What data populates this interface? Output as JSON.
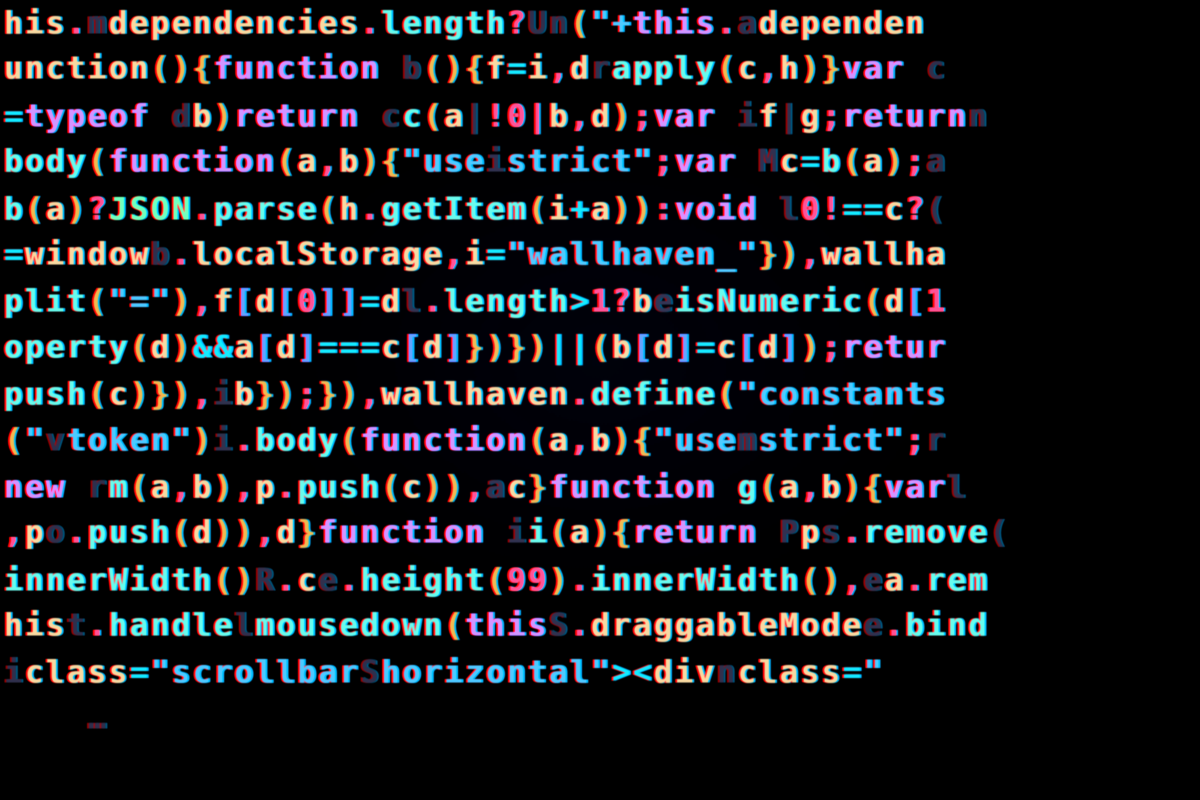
{
  "meta": {
    "description": "Close-up macro photo of a syntax-highlighted minified JavaScript file on an LCD screen, with chromatic aberration. Text is cropped on all sides.",
    "font": "monospace",
    "approx_font_px": 31,
    "line_height_px": 46.4,
    "columns_visible_approx": 55,
    "colors": {
      "background": "#000000",
      "identifier": "#e6d6b8",
      "function": "#9ae8e0",
      "keyword": "#bfa0ff",
      "number_punc": "#ff6e92",
      "string": "#7bbde0",
      "operator": "#61d4e6",
      "paren_brace": "#d5b880",
      "bracket": "#7ea0ff",
      "dim": "#6a6a88",
      "type": "#a8ffd0"
    }
  },
  "syntax_legend": {
    "id": "identifier",
    "fn": "function-name",
    "kw": "keyword",
    "num": "number-literal",
    "str": "string-literal",
    "op": "operator",
    "pun": "paren-or-brace",
    "brkt": "square-bracket",
    "dim": "ghost-char",
    "type": "builtin-type"
  },
  "code_lines": [
    [
      [
        "id",
        "his"
      ],
      [
        "num",
        "."
      ],
      [
        "dim",
        "m"
      ],
      [
        "id",
        "dependencies"
      ],
      [
        "num",
        "."
      ],
      [
        "fn",
        "length"
      ],
      [
        "num",
        "?"
      ],
      [
        "dim",
        "Un"
      ],
      [
        "pun",
        "("
      ],
      [
        "str",
        "\"+"
      ],
      [
        "kw",
        "this"
      ],
      [
        "num",
        "."
      ],
      [
        "dim",
        "a"
      ],
      [
        "id",
        "dependen"
      ]
    ],
    [
      [
        "id",
        "unction"
      ],
      [
        "pun",
        "("
      ],
      [
        "pun",
        ")"
      ],
      [
        "pun",
        "{"
      ],
      [
        "kw",
        "function "
      ],
      [
        "dim",
        "b"
      ],
      [
        "pun",
        "("
      ],
      [
        "pun",
        ")"
      ],
      [
        "pun",
        "{"
      ],
      [
        "id",
        "f"
      ],
      [
        "op",
        "="
      ],
      [
        "id",
        "i"
      ],
      [
        "num",
        ","
      ],
      [
        "id",
        "d"
      ],
      [
        "dim",
        "r"
      ],
      [
        "fn",
        "apply"
      ],
      [
        "pun",
        "("
      ],
      [
        "id",
        "c"
      ],
      [
        "num",
        ","
      ],
      [
        "id",
        "h"
      ],
      [
        "pun",
        ")"
      ],
      [
        "pun",
        "}"
      ],
      [
        "kw",
        "var "
      ],
      [
        "dim",
        "c"
      ]
    ],
    [
      [
        "op",
        "="
      ],
      [
        "kw",
        "typeof "
      ],
      [
        "dim",
        "d"
      ],
      [
        "id",
        "b"
      ],
      [
        "pun",
        ")"
      ],
      [
        "kw",
        "return "
      ],
      [
        "dim",
        "c"
      ],
      [
        "fn",
        "c"
      ],
      [
        "pun",
        "("
      ],
      [
        "id",
        "a"
      ],
      [
        "dim",
        "|"
      ],
      [
        "num",
        "!"
      ],
      [
        "num",
        "0"
      ],
      [
        "num",
        "|"
      ],
      [
        "id",
        "b"
      ],
      [
        "num",
        ","
      ],
      [
        "id",
        "d"
      ],
      [
        "pun",
        ")"
      ],
      [
        "num",
        ";"
      ],
      [
        "kw",
        "var "
      ],
      [
        "dim",
        "i"
      ],
      [
        "id",
        "f"
      ],
      [
        "dim",
        "|"
      ],
      [
        "id",
        "g"
      ],
      [
        "num",
        ";"
      ],
      [
        "kw",
        "return"
      ],
      [
        "dim",
        "n"
      ]
    ],
    [
      [
        "fn",
        "body"
      ],
      [
        "pun",
        "("
      ],
      [
        "kw",
        "function"
      ],
      [
        "pun",
        "("
      ],
      [
        "id",
        "a"
      ],
      [
        "num",
        ","
      ],
      [
        "id",
        "b"
      ],
      [
        "pun",
        ")"
      ],
      [
        "pun",
        "{"
      ],
      [
        "str",
        "\"use"
      ],
      [
        "dim",
        "i"
      ],
      [
        "str",
        "strict\""
      ],
      [
        "num",
        ";"
      ],
      [
        "kw",
        "var "
      ],
      [
        "dim",
        "M"
      ],
      [
        "id",
        "c"
      ],
      [
        "op",
        "="
      ],
      [
        "fn",
        "b"
      ],
      [
        "pun",
        "("
      ],
      [
        "id",
        "a"
      ],
      [
        "pun",
        ")"
      ],
      [
        "num",
        ";"
      ],
      [
        "dim",
        "a"
      ]
    ],
    [
      [
        "fn",
        "b"
      ],
      [
        "pun",
        "("
      ],
      [
        "id",
        "a"
      ],
      [
        "pun",
        ")"
      ],
      [
        "num",
        "?"
      ],
      [
        "type",
        "JSON"
      ],
      [
        "num",
        "."
      ],
      [
        "fn",
        "parse"
      ],
      [
        "pun",
        "("
      ],
      [
        "id",
        "h"
      ],
      [
        "num",
        "."
      ],
      [
        "fn",
        "getItem"
      ],
      [
        "pun",
        "("
      ],
      [
        "id",
        "i"
      ],
      [
        "op",
        "+"
      ],
      [
        "id",
        "a"
      ],
      [
        "pun",
        ")"
      ],
      [
        "pun",
        ")"
      ],
      [
        "num",
        ":"
      ],
      [
        "kw",
        "void "
      ],
      [
        "dim",
        "l"
      ],
      [
        "num",
        "0"
      ],
      [
        "num",
        "!"
      ],
      [
        "op",
        "=="
      ],
      [
        "id",
        "c"
      ],
      [
        "num",
        "?"
      ],
      [
        "dim",
        "("
      ]
    ],
    [
      [
        "op",
        "="
      ],
      [
        "id",
        "window"
      ],
      [
        "dim",
        "b"
      ],
      [
        "num",
        "."
      ],
      [
        "id",
        "localStorage"
      ],
      [
        "num",
        ","
      ],
      [
        "id",
        "i"
      ],
      [
        "op",
        "="
      ],
      [
        "str",
        "\"wallhaven_\""
      ],
      [
        "pun",
        "}"
      ],
      [
        "pun",
        ")"
      ],
      [
        "num",
        ","
      ],
      [
        "id",
        "wallha"
      ]
    ],
    [
      [
        "fn",
        "plit"
      ],
      [
        "pun",
        "("
      ],
      [
        "str",
        "\"=\""
      ],
      [
        "pun",
        ")"
      ],
      [
        "num",
        ","
      ],
      [
        "id",
        "f"
      ],
      [
        "brkt",
        "["
      ],
      [
        "id",
        "d"
      ],
      [
        "brkt",
        "["
      ],
      [
        "num",
        "0"
      ],
      [
        "brkt",
        "]"
      ],
      [
        "brkt",
        "]"
      ],
      [
        "op",
        "="
      ],
      [
        "id",
        "d"
      ],
      [
        "dim",
        "l"
      ],
      [
        "num",
        "."
      ],
      [
        "fn",
        "length"
      ],
      [
        "op",
        ">"
      ],
      [
        "num",
        "1"
      ],
      [
        "num",
        "?"
      ],
      [
        "id",
        "b"
      ],
      [
        "dim",
        "e"
      ],
      [
        "fn",
        "isNumeric"
      ],
      [
        "pun",
        "("
      ],
      [
        "id",
        "d"
      ],
      [
        "brkt",
        "["
      ],
      [
        "num",
        "1"
      ]
    ],
    [
      [
        "fn",
        "operty"
      ],
      [
        "pun",
        "("
      ],
      [
        "id",
        "d"
      ],
      [
        "pun",
        ")"
      ],
      [
        "op",
        "&&"
      ],
      [
        "id",
        "a"
      ],
      [
        "brkt",
        "["
      ],
      [
        "id",
        "d"
      ],
      [
        "brkt",
        "]"
      ],
      [
        "op",
        "==="
      ],
      [
        "id",
        "c"
      ],
      [
        "brkt",
        "["
      ],
      [
        "id",
        "d"
      ],
      [
        "brkt",
        "]"
      ],
      [
        "pun",
        "}"
      ],
      [
        "pun",
        ")"
      ],
      [
        "pun",
        "}"
      ],
      [
        "pun",
        ")"
      ],
      [
        "op",
        "||"
      ],
      [
        "pun",
        "("
      ],
      [
        "id",
        "b"
      ],
      [
        "brkt",
        "["
      ],
      [
        "id",
        "d"
      ],
      [
        "brkt",
        "]"
      ],
      [
        "op",
        "="
      ],
      [
        "id",
        "c"
      ],
      [
        "brkt",
        "["
      ],
      [
        "id",
        "d"
      ],
      [
        "brkt",
        "]"
      ],
      [
        "pun",
        ")"
      ],
      [
        "num",
        ";"
      ],
      [
        "kw",
        "retur"
      ]
    ],
    [
      [
        "fn",
        "push"
      ],
      [
        "pun",
        "("
      ],
      [
        "id",
        "c"
      ],
      [
        "pun",
        ")"
      ],
      [
        "pun",
        "}"
      ],
      [
        "pun",
        ")"
      ],
      [
        "num",
        ","
      ],
      [
        "dim",
        "i"
      ],
      [
        "id",
        "b"
      ],
      [
        "pun",
        "}"
      ],
      [
        "pun",
        ")"
      ],
      [
        "num",
        ";"
      ],
      [
        "pun",
        "}"
      ],
      [
        "pun",
        ")"
      ],
      [
        "num",
        ","
      ],
      [
        "id",
        "wallhaven"
      ],
      [
        "num",
        "."
      ],
      [
        "fn",
        "define"
      ],
      [
        "pun",
        "("
      ],
      [
        "str",
        "\"constants"
      ]
    ],
    [
      [
        "pun",
        "("
      ],
      [
        "str",
        "\""
      ],
      [
        "dim",
        "v"
      ],
      [
        "str",
        "token\""
      ],
      [
        "pun",
        ")"
      ],
      [
        "dim",
        "i"
      ],
      [
        "num",
        "."
      ],
      [
        "fn",
        "body"
      ],
      [
        "pun",
        "("
      ],
      [
        "kw",
        "function"
      ],
      [
        "pun",
        "("
      ],
      [
        "id",
        "a"
      ],
      [
        "num",
        ","
      ],
      [
        "id",
        "b"
      ],
      [
        "pun",
        ")"
      ],
      [
        "pun",
        "{"
      ],
      [
        "str",
        "\"use"
      ],
      [
        "dim",
        "m"
      ],
      [
        "str",
        "strict\""
      ],
      [
        "num",
        ";"
      ],
      [
        "dim",
        "r"
      ]
    ],
    [
      [
        "kw",
        "new "
      ],
      [
        "dim",
        "r"
      ],
      [
        "fn",
        "m"
      ],
      [
        "pun",
        "("
      ],
      [
        "id",
        "a"
      ],
      [
        "num",
        ","
      ],
      [
        "id",
        "b"
      ],
      [
        "pun",
        ")"
      ],
      [
        "num",
        ","
      ],
      [
        "id",
        "p"
      ],
      [
        "num",
        "."
      ],
      [
        "fn",
        "push"
      ],
      [
        "pun",
        "("
      ],
      [
        "id",
        "c"
      ],
      [
        "pun",
        ")"
      ],
      [
        "pun",
        ")"
      ],
      [
        "num",
        ","
      ],
      [
        "dim",
        "a"
      ],
      [
        "id",
        "c"
      ],
      [
        "pun",
        "}"
      ],
      [
        "kw",
        "function "
      ],
      [
        "fn",
        "g"
      ],
      [
        "pun",
        "("
      ],
      [
        "id",
        "a"
      ],
      [
        "num",
        ","
      ],
      [
        "id",
        "b"
      ],
      [
        "pun",
        ")"
      ],
      [
        "pun",
        "{"
      ],
      [
        "kw",
        "var"
      ],
      [
        "dim",
        "l"
      ]
    ],
    [
      [
        "num",
        ","
      ],
      [
        "id",
        "p"
      ],
      [
        "dim",
        "o"
      ],
      [
        "num",
        "."
      ],
      [
        "fn",
        "push"
      ],
      [
        "pun",
        "("
      ],
      [
        "id",
        "d"
      ],
      [
        "pun",
        ")"
      ],
      [
        "pun",
        ")"
      ],
      [
        "num",
        ","
      ],
      [
        "id",
        "d"
      ],
      [
        "pun",
        "}"
      ],
      [
        "kw",
        "function "
      ],
      [
        "dim",
        "i"
      ],
      [
        "fn",
        "i"
      ],
      [
        "pun",
        "("
      ],
      [
        "id",
        "a"
      ],
      [
        "pun",
        ")"
      ],
      [
        "pun",
        "{"
      ],
      [
        "kw",
        "return "
      ],
      [
        "dim",
        "P"
      ],
      [
        "id",
        "p"
      ],
      [
        "dim",
        "s"
      ],
      [
        "num",
        "."
      ],
      [
        "fn",
        "remove"
      ],
      [
        "dim",
        "("
      ]
    ],
    [
      [
        "fn",
        "innerWidth"
      ],
      [
        "pun",
        "("
      ],
      [
        "pun",
        ")"
      ],
      [
        "dim",
        "R"
      ],
      [
        "num",
        "."
      ],
      [
        "id",
        "c"
      ],
      [
        "dim",
        "e"
      ],
      [
        "num",
        "."
      ],
      [
        "fn",
        "height"
      ],
      [
        "pun",
        "("
      ],
      [
        "num",
        "99"
      ],
      [
        "pun",
        ")"
      ],
      [
        "num",
        "."
      ],
      [
        "fn",
        "innerWidth"
      ],
      [
        "pun",
        "("
      ],
      [
        "pun",
        ")"
      ],
      [
        "num",
        ","
      ],
      [
        "dim",
        "e"
      ],
      [
        "id",
        "a"
      ],
      [
        "num",
        "."
      ],
      [
        "fn",
        "rem"
      ]
    ],
    [
      [
        "id",
        "his"
      ],
      [
        "dim",
        "t"
      ],
      [
        "num",
        "."
      ],
      [
        "fn",
        "handle"
      ],
      [
        "dim",
        "l"
      ],
      [
        "fn",
        "mousedown"
      ],
      [
        "pun",
        "("
      ],
      [
        "kw",
        "this"
      ],
      [
        "dim",
        "S"
      ],
      [
        "num",
        "."
      ],
      [
        "id",
        "draggableMode"
      ],
      [
        "dim",
        "e"
      ],
      [
        "num",
        "."
      ],
      [
        "fn",
        "bind"
      ]
    ],
    [
      [
        "dim",
        "i"
      ],
      [
        "id",
        "class"
      ],
      [
        "op",
        "="
      ],
      [
        "str",
        "\"scrollbar"
      ],
      [
        "dim",
        "S"
      ],
      [
        "str",
        "horizontal\""
      ],
      [
        "op",
        ">"
      ],
      [
        "op",
        "<"
      ],
      [
        "id",
        "div"
      ],
      [
        "dim",
        "n"
      ],
      [
        "id",
        "class"
      ],
      [
        "op",
        "="
      ],
      [
        "str",
        "\""
      ]
    ],
    [
      [
        "dim",
        "    …    "
      ]
    ]
  ]
}
